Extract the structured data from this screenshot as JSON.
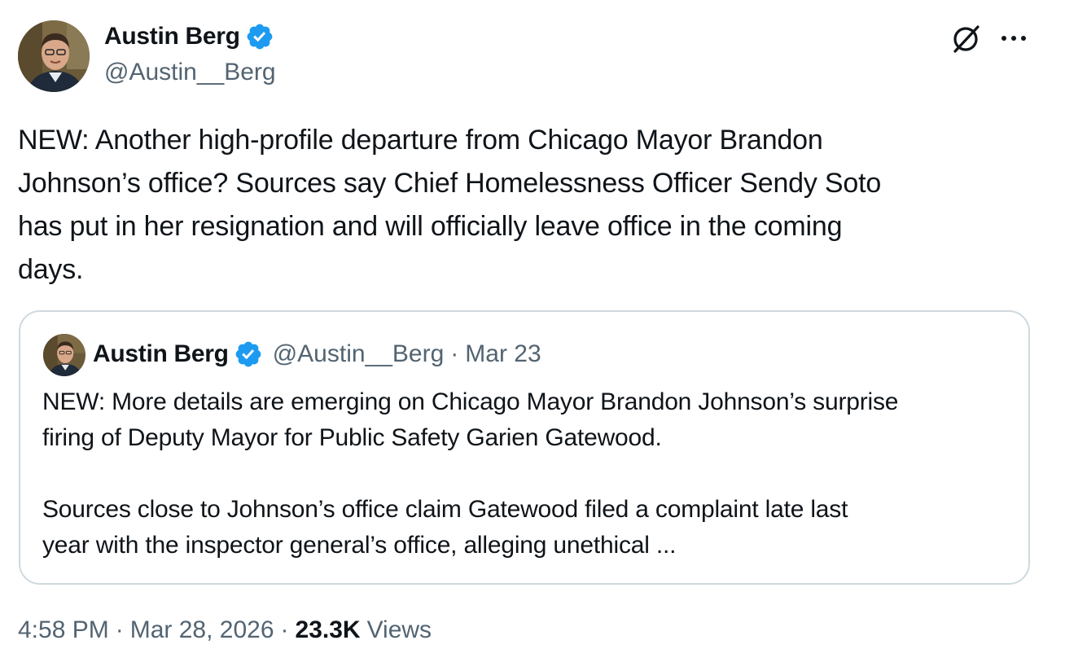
{
  "author": {
    "display_name": "Austin Berg",
    "handle": "@Austin__Berg",
    "avatar_icon": "profile-photo",
    "verified_icon": "verified-badge-icon",
    "verified_color": "#1d9bf0"
  },
  "tweet": {
    "text": "NEW: Another high-profile departure from Chicago Mayor Brandon\nJohnson’s office? Sources say Chief Homelessness Officer Sendy Soto\nhas put in her resignation and will officially leave office in the coming\ndays."
  },
  "quoted_tweet": {
    "display_name": "Austin Berg",
    "handle": "@Austin__Berg",
    "separator": "·",
    "date": "Mar 23",
    "text": "NEW: More details are emerging on Chicago Mayor Brandon Johnson’s surprise\nfiring of Deputy Mayor for Public Safety Garien Gatewood.\n\nSources close to Johnson’s office claim Gatewood filed a complaint late last\nyear with the inspector general’s office, alleging unethical ..."
  },
  "meta": {
    "time": "4:58 PM",
    "separator": "·",
    "date": "Mar 28, 2026",
    "views_count": "23.3K",
    "views_label": "Views"
  },
  "icons": {
    "grok": "grok-icon",
    "more": "more-horizontal-icon"
  },
  "colors": {
    "text": "#0f1419",
    "secondary": "#536471",
    "border": "#cfd9de",
    "verified": "#1d9bf0"
  }
}
